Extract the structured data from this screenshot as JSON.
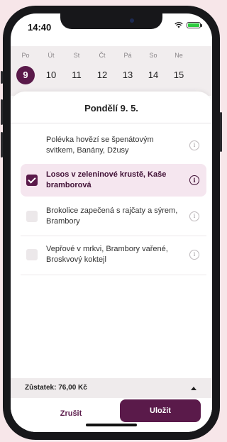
{
  "status": {
    "time": "14:40"
  },
  "week": {
    "days": [
      {
        "name": "Po",
        "date": "9",
        "selected": true
      },
      {
        "name": "Út",
        "date": "10"
      },
      {
        "name": "St",
        "date": "11"
      },
      {
        "name": "Čt",
        "date": "12"
      },
      {
        "name": "Pá",
        "date": "13"
      },
      {
        "name": "So",
        "date": "14"
      },
      {
        "name": "Ne",
        "date": "15"
      }
    ]
  },
  "sheet": {
    "title": "Pondělí 9. 5."
  },
  "menu": [
    {
      "text": "Polévka hovězí se špenátovým svitkem, Banány, Džusy",
      "checked": false,
      "checkbox": false
    },
    {
      "text": "Losos v zeleninové krustě, Kaše bramborová",
      "checked": true,
      "checkbox": true
    },
    {
      "text": "Brokolice zapečená s rajčaty a sýrem, Brambory",
      "checked": false,
      "checkbox": true
    },
    {
      "text": "Vepřové v mrkvi, Brambory vařené, Broskvový koktejl",
      "checked": false,
      "checkbox": true
    }
  ],
  "info_glyph": "i",
  "footer": {
    "balance": "Zůstatek: 76,00 Kč",
    "cancel_label": "Zrušit",
    "save_label": "Uložit"
  },
  "colors": {
    "accent": "#5a1a4a",
    "selected_bg": "#f5e6ef",
    "page_bg": "#f7e6e9"
  }
}
